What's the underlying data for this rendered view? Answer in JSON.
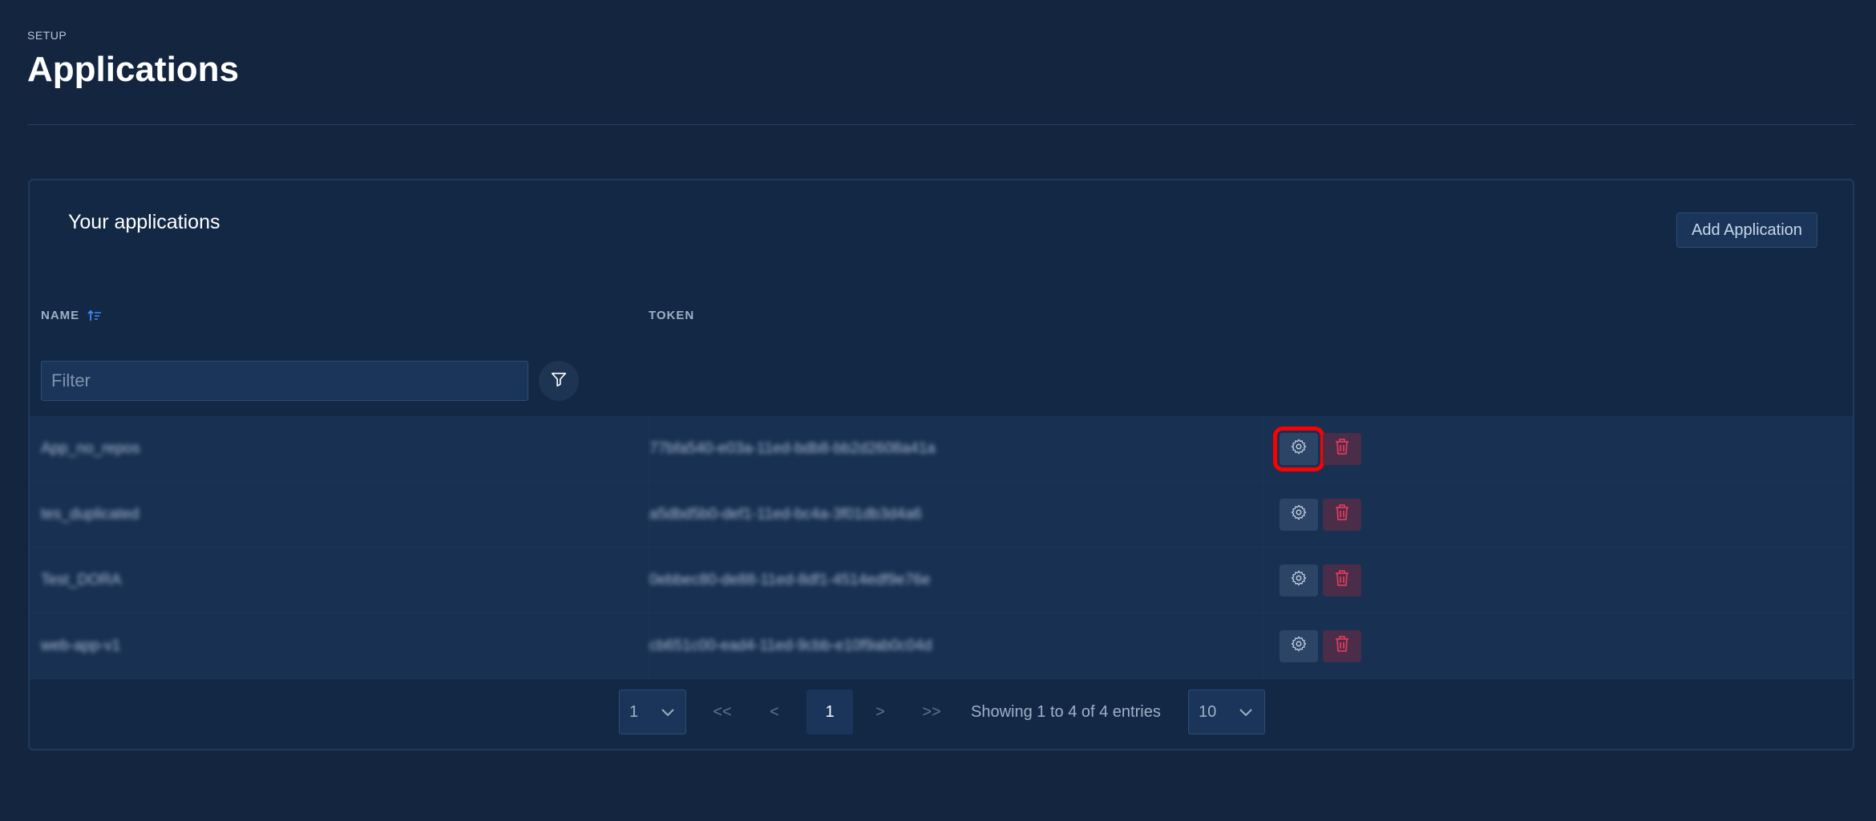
{
  "header": {
    "breadcrumb": "SETUP",
    "title": "Applications"
  },
  "card": {
    "title": "Your applications",
    "add_button": "Add Application"
  },
  "table": {
    "columns": {
      "name": "NAME",
      "token": "TOKEN"
    },
    "filter_placeholder": "Filter",
    "rows": [
      {
        "name": "App_no_repos",
        "token": "77bfa540-e03a-11ed-bdb8-bb2d2608a41a"
      },
      {
        "name": "tes_duplicated",
        "token": "a5dbd5b0-def1-11ed-bc4a-3f01db3d4a6"
      },
      {
        "name": "Test_DORA",
        "token": "0ebbec80-de88-11ed-8df1-4514edf9e76e"
      },
      {
        "name": "web-app-v1",
        "token": "cb651c00-ead4-11ed-9cbb-e10f9ab0c04d"
      }
    ]
  },
  "pagination": {
    "page_select": "1",
    "current_page": "1",
    "info": "Showing 1 to 4 of 4 entries",
    "page_size": "10",
    "first": "<<",
    "prev": "<",
    "next": ">",
    "last": ">>"
  },
  "colors": {
    "background": "#13253f",
    "accent": "#3d8bff",
    "danger": "#e03a5a",
    "highlight": "#ff0000"
  },
  "icons": [
    "sort-icon",
    "filter-icon",
    "gear-icon",
    "trash-icon",
    "chevron-down-icon"
  ]
}
